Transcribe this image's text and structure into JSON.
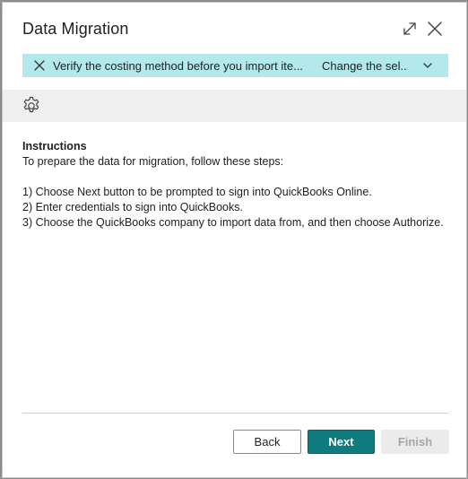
{
  "dialog": {
    "title": "Data Migration"
  },
  "notification": {
    "message": "Verify the costing method before you import ite...",
    "action": "Change the sel..."
  },
  "content": {
    "heading": "Instructions",
    "intro": "To prepare the data for migration, follow these steps:",
    "steps": [
      "1) Choose Next button to be prompted to sign into QuickBooks Online.",
      "2) Enter credentials to sign into QuickBooks.",
      "3) Choose the QuickBooks company to import data from, and then choose Authorize."
    ]
  },
  "buttons": {
    "back": "Back",
    "next": "Next",
    "finish": "Finish"
  },
  "colors": {
    "accent": "#0f7b7e",
    "notification_bg": "#b3e9ec",
    "toolbar_bg": "#efefef"
  },
  "icons": [
    "expand-icon",
    "close-icon",
    "gear-icon",
    "chevron-down-icon"
  ]
}
